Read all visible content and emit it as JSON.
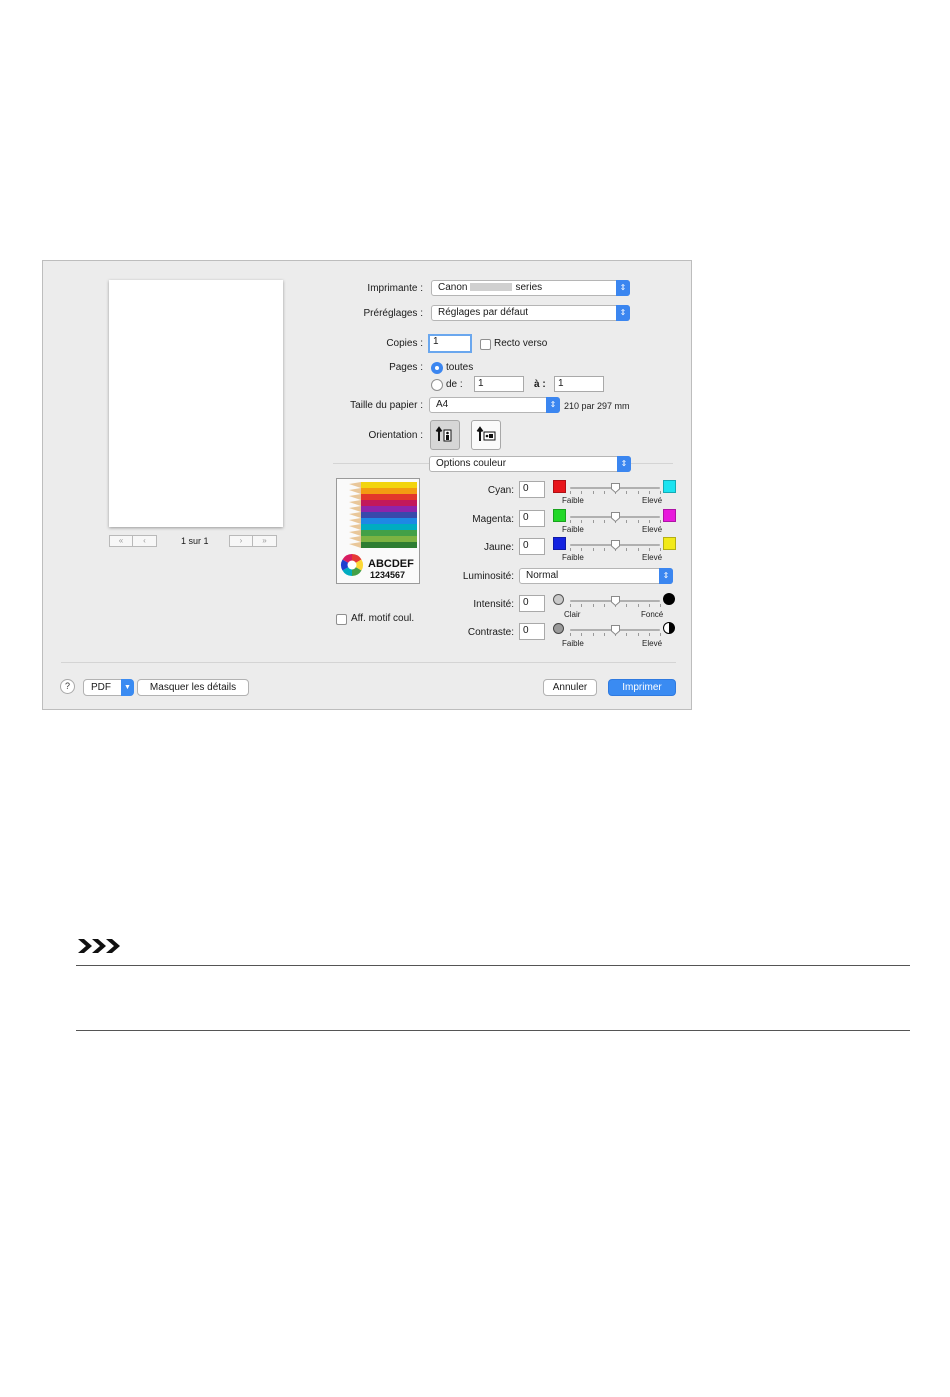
{
  "dialog": {
    "preview": {
      "page_count": "1 sur 1"
    },
    "printer": {
      "label": "Imprimante :",
      "value_prefix": "Canon",
      "value_suffix": "series"
    },
    "presets": {
      "label": "Préréglages :",
      "value": "Réglages par défaut"
    },
    "copies": {
      "label": "Copies :",
      "value": "1",
      "duplex_label": "Recto verso"
    },
    "pages": {
      "label": "Pages :",
      "all_label": "toutes",
      "from_label": "de :",
      "from_value": "1",
      "to_label": "à :",
      "to_value": "1"
    },
    "paper_size": {
      "label": "Taille du papier :",
      "value": "A4",
      "dimensions": "210 par 297 mm"
    },
    "orientation": {
      "label": "Orientation :"
    },
    "panel_menu": {
      "value": "Options couleur"
    },
    "sample": {
      "line1": "ABCDEF",
      "line2": "1234567"
    },
    "color_pattern": {
      "label": "Aff. motif coul."
    },
    "cyan": {
      "label": "Cyan:",
      "value": "0",
      "min_label": "Faible",
      "max_label": "Elevé",
      "min_color": "#e8151b",
      "max_color": "#1be3f0",
      "level": 0.5
    },
    "magenta": {
      "label": "Magenta:",
      "value": "0",
      "min_label": "Faible",
      "max_label": "Elevé",
      "min_color": "#22d828",
      "max_color": "#e81adc",
      "level": 0.5
    },
    "yellow": {
      "label": "Jaune:",
      "value": "0",
      "min_label": "Faible",
      "max_label": "Elevé",
      "min_color": "#1423e0",
      "max_color": "#f2ea1a",
      "level": 0.5
    },
    "brightness": {
      "label": "Luminosité:",
      "value": "Normal"
    },
    "intensity": {
      "label": "Intensité:",
      "value": "0",
      "min_label": "Clair",
      "max_label": "Foncé",
      "level": 0.5
    },
    "contrast": {
      "label": "Contraste:",
      "value": "0",
      "min_label": "Faible",
      "max_label": "Elevé",
      "level": 0.5
    },
    "footer": {
      "help": "?",
      "pdf": "PDF",
      "hide_details": "Masquer les détails",
      "cancel": "Annuler",
      "print": "Imprimer"
    }
  },
  "colors": {
    "accent": "#3a8bf2",
    "dialog_bg": "#ececec"
  }
}
